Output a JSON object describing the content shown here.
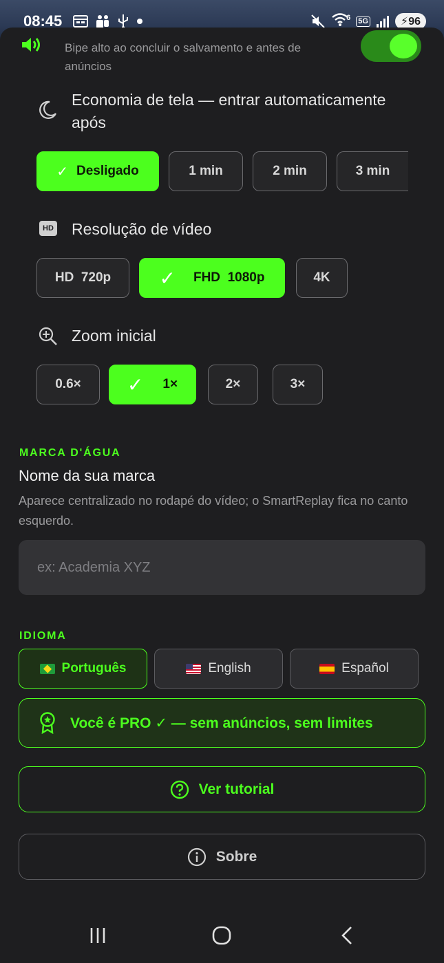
{
  "status_bar": {
    "time": "08:45",
    "icons_left": [
      "calendar-icon",
      "teams-icon",
      "usb-icon",
      "dot-icon"
    ],
    "icons_right": [
      "mute-icon",
      "wifi-icon",
      "5g-icon",
      "signal-icon"
    ],
    "wifi_badge": "6",
    "network": "5G",
    "battery": "96"
  },
  "beep": {
    "text": "Bipe alto ao concluir o salvamento e antes de anúncios",
    "enabled": true
  },
  "screen_saver": {
    "label": "Economia de tela — entrar automaticamente após",
    "options": [
      "Desligado",
      "1 min",
      "2 min",
      "3 min"
    ],
    "selected": "Desligado"
  },
  "resolution": {
    "label": "Resolução de vídeo",
    "icon_text": "HD",
    "options": [
      "HD  720p",
      "FHD  1080p",
      "4K"
    ],
    "selected": "FHD  1080p"
  },
  "zoom": {
    "label": "Zoom inicial",
    "options": [
      "0.6×",
      "1×",
      "2×",
      "3×"
    ],
    "selected": "1×"
  },
  "watermark": {
    "section_title": "MARCA D'ÁGUA",
    "title": "Nome da sua marca",
    "description": "Aparece centralizado no rodapé do vídeo; o SmartReplay fica no canto esquerdo.",
    "placeholder": "ex: Academia XYZ",
    "value": ""
  },
  "language": {
    "section_title": "IDIOMA",
    "options": [
      "Português",
      "English",
      "Español"
    ],
    "selected": "Português"
  },
  "pro_banner": "Você é PRO ✓ — sem anúncios, sem limites",
  "tutorial_button": "Ver tutorial",
  "about_button": "Sobre",
  "colors": {
    "accent": "#4cff1e",
    "background": "#1e1e20",
    "chip_border": "#6a6a6d"
  }
}
